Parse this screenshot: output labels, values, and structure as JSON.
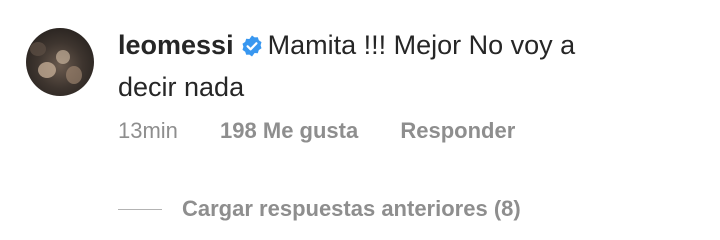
{
  "comment": {
    "username": "leomessi",
    "verified_icon": "verified-badge-icon",
    "text_line1": "Mamita !!! Mejor No voy a",
    "text_line2": "decir nada",
    "time": "13min",
    "likes": "198 Me gusta",
    "reply": "Responder",
    "load_more": "Cargar respuestas anteriores (8)"
  },
  "colors": {
    "text": "#262626",
    "meta": "#8e8e8e",
    "verified": "#3897f0"
  }
}
